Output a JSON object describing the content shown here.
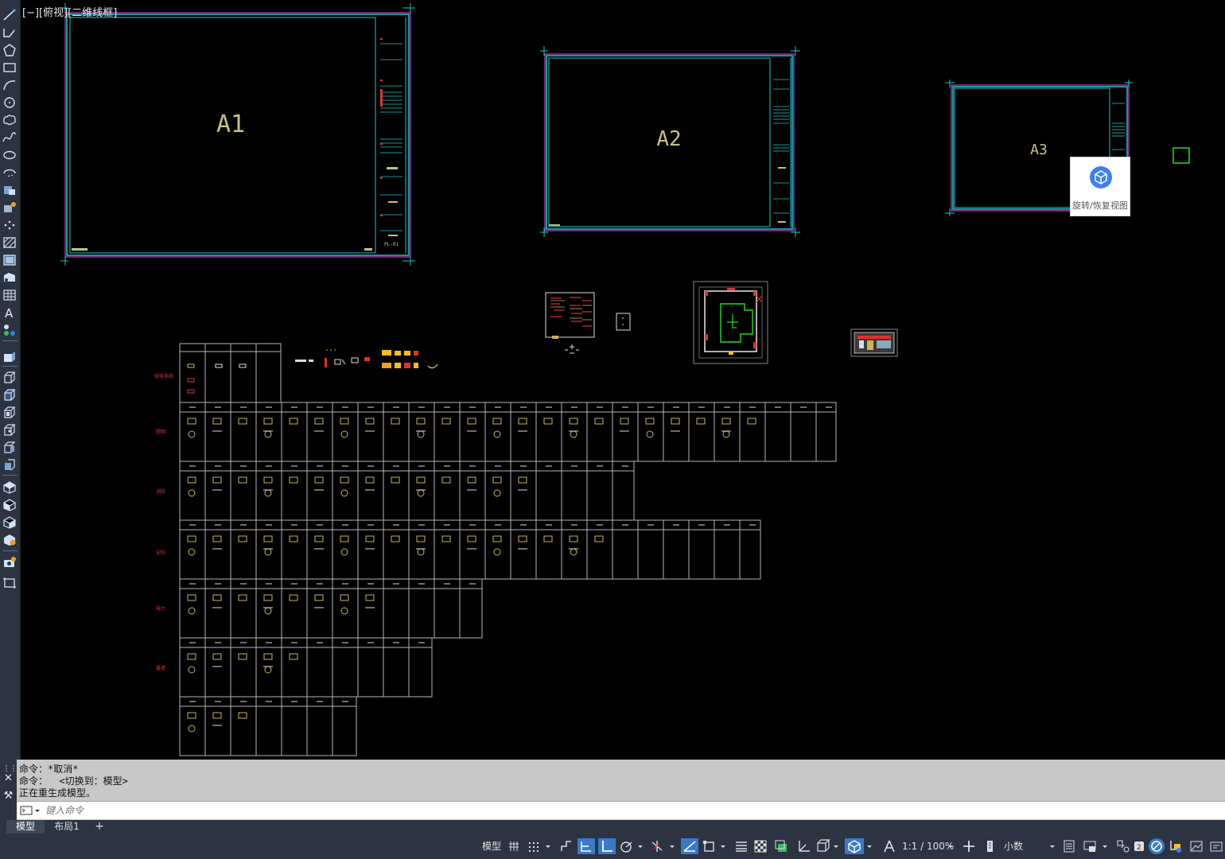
{
  "viewport": {
    "label": "[−][俯视][二维线框]",
    "sheets": [
      {
        "label": "A1"
      },
      {
        "label": "A2"
      },
      {
        "label": "A3"
      }
    ],
    "title_block_code": "PL-01",
    "category_labels": [
      "弱电系统",
      "照明",
      "消防",
      "安防",
      "电力",
      "暮墙",
      ""
    ],
    "colors": {
      "background": "#000000",
      "sheet_outer": "#c83cc8",
      "sheet_inner": "#19c8c8",
      "label_text": "#c8c27a",
      "table_lines": "#b4b4b4",
      "symbols": "#c8b45a",
      "accent_red": "#e03030",
      "accent_green": "#20e020"
    }
  },
  "viewcube": {
    "label": "旋转/恢复视图",
    "icon": "cube-icon"
  },
  "command": {
    "history": [
      "命令：*取消*",
      "命令：  <切换到：模型>",
      "正在重生成模型。"
    ],
    "input_placeholder": "键入命令"
  },
  "tabs": {
    "items": [
      {
        "label": "模型",
        "active": true
      },
      {
        "label": "布局1",
        "active": false
      }
    ],
    "add_label": "+"
  },
  "status_bar": {
    "model_label": "模型",
    "scale_label": "1:1 / 100%",
    "units_label": "小数"
  },
  "palette_tools": [
    "line-icon",
    "polyline-icon",
    "polygon-icon",
    "rectangle-icon",
    "arc-icon",
    "circle-icon",
    "revcloud-icon",
    "spline-icon",
    "ellipse-icon",
    "ellipse-arc-icon",
    "insert-block-icon",
    "make-block-icon",
    "point-icon",
    "hatch-icon",
    "gradient-icon",
    "region-icon",
    "table-icon",
    "text-icon",
    "add-selected-icon",
    "extrude-icon",
    "box-icon",
    "wedge-icon",
    "cone-icon",
    "sphere-icon",
    "cylinder-icon",
    "union-icon",
    "subtract-icon",
    "intersect-icon",
    "interfere-icon",
    "camera-icon",
    "viewport-icon"
  ]
}
